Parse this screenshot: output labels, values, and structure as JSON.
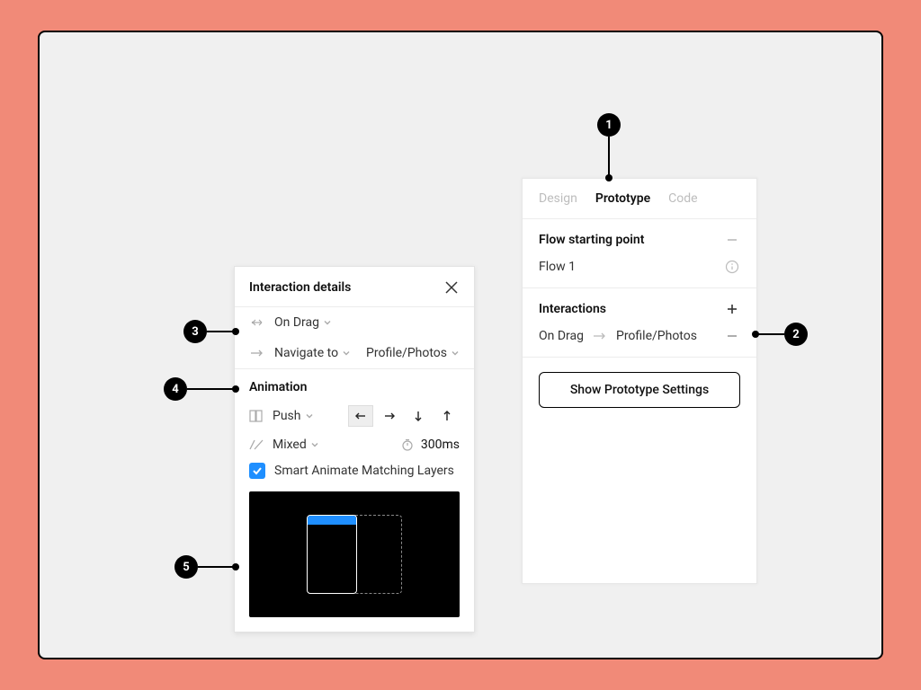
{
  "callouts": {
    "n1": "1",
    "n2": "2",
    "n3": "3",
    "n4": "4",
    "n5": "5"
  },
  "left_panel": {
    "title": "Interaction details",
    "trigger_label": "On Drag",
    "action_label": "Navigate to",
    "action_target": "Profile/Photos",
    "animation_section_label": "Animation",
    "anim_type": "Push",
    "easing": "Mixed",
    "duration": "300ms",
    "smart_animate_label": "Smart Animate Matching Layers"
  },
  "right_panel": {
    "tabs": {
      "design": "Design",
      "prototype": "Prototype",
      "code": "Code"
    },
    "flow_section": {
      "header": "Flow starting point",
      "flow_name": "Flow 1"
    },
    "interactions_section": {
      "header": "Interactions",
      "row_trigger": "On Drag",
      "row_target": "Profile/Photos"
    },
    "settings_button": "Show Prototype Settings"
  }
}
